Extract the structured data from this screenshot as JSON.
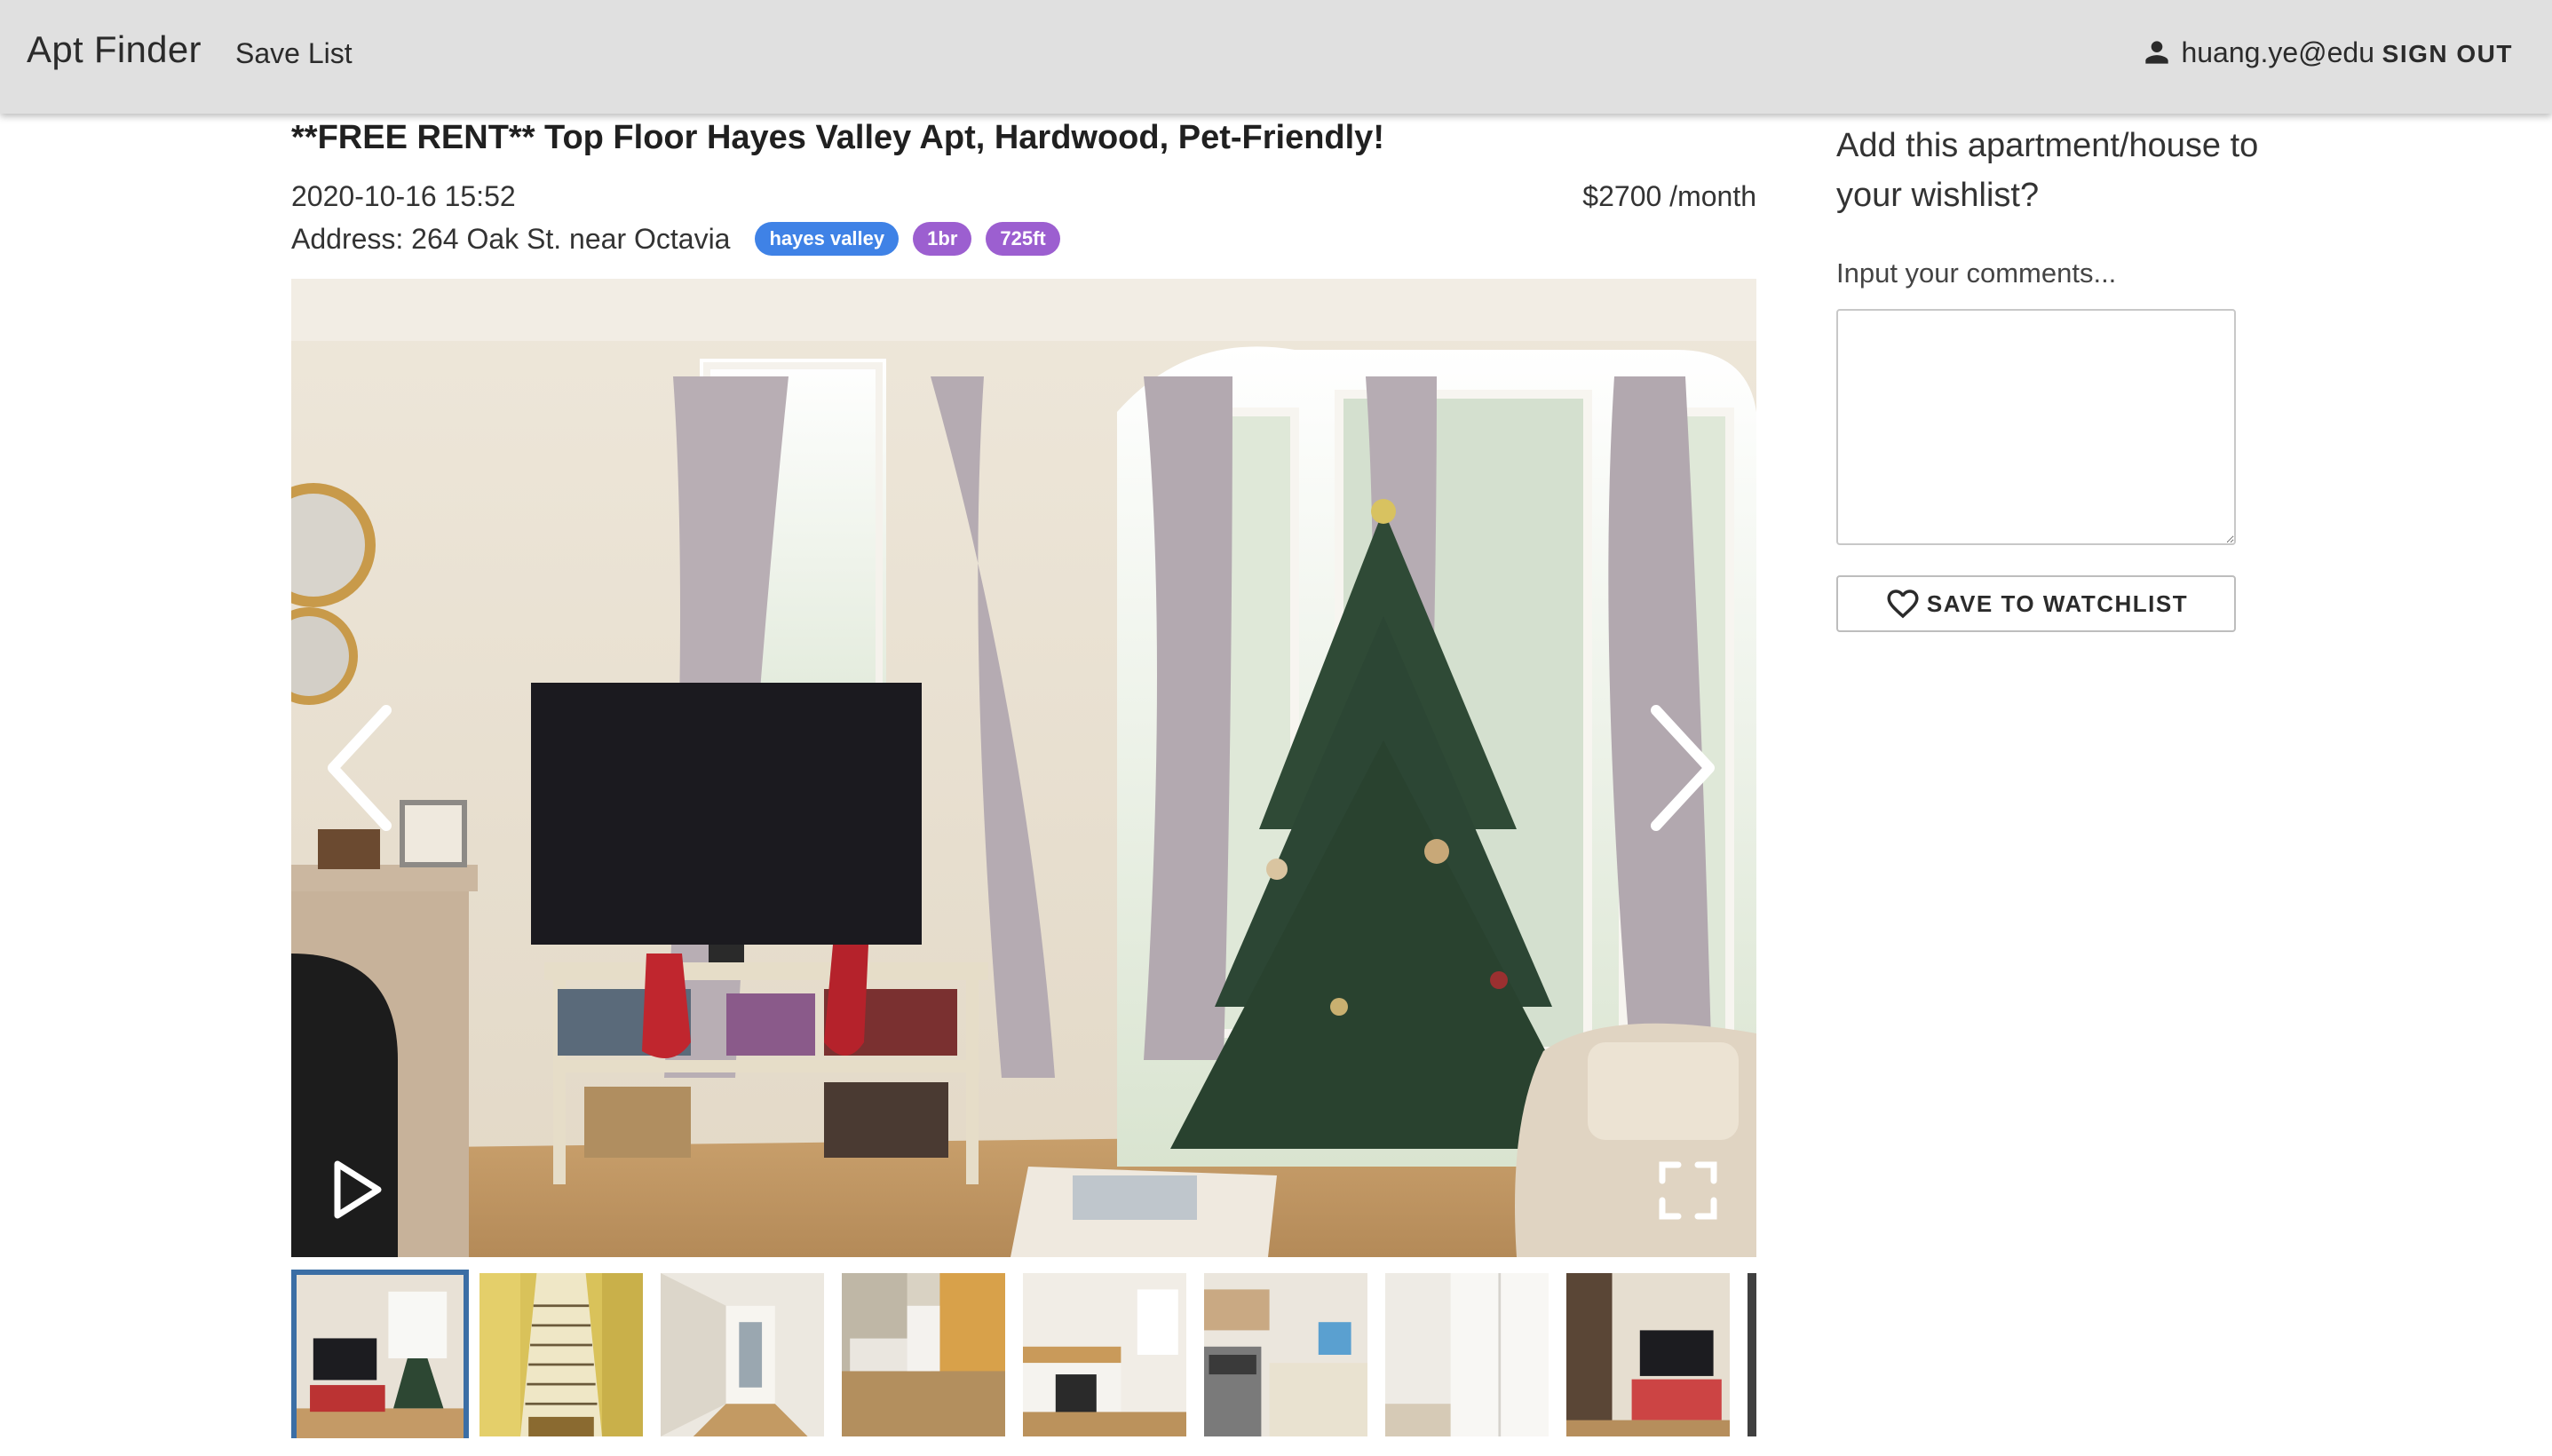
{
  "app": {
    "brand": "Apt Finder",
    "nav_save_list": "Save List",
    "user_email": "huang.ye@edu",
    "sign_out": "SIGN OUT"
  },
  "listing": {
    "title": "**FREE RENT** Top Floor Hayes Valley Apt, Hardwood, Pet-Friendly!",
    "posted": "2020-10-16 15:52",
    "price": "$2700 /month",
    "address": "Address: 264 Oak St. near Octavia",
    "tags": [
      {
        "label": "hayes valley",
        "color": "#3f82e6"
      },
      {
        "label": "1br",
        "color": "#9c5fd0"
      },
      {
        "label": "725ft",
        "color": "#9c5fd0"
      }
    ]
  },
  "gallery": {
    "icons": [
      "chevron-left-icon",
      "chevron-right-icon",
      "play-icon",
      "fullscreen-icon"
    ],
    "thumbnail_count": 9,
    "active_thumbnail": 1
  },
  "wishlist": {
    "heading": "Add this apartment/house to your wishlist?",
    "comments_label": "Input your comments...",
    "save_label": "SAVE TO WATCHLIST",
    "button_icon": "heart-outline-icon"
  },
  "colors": {
    "appbar": "#e0e0e0",
    "tag_blue": "#3f82e6",
    "tag_purple": "#9c5fd0",
    "active_thumb_border": "#3b6ea5"
  }
}
